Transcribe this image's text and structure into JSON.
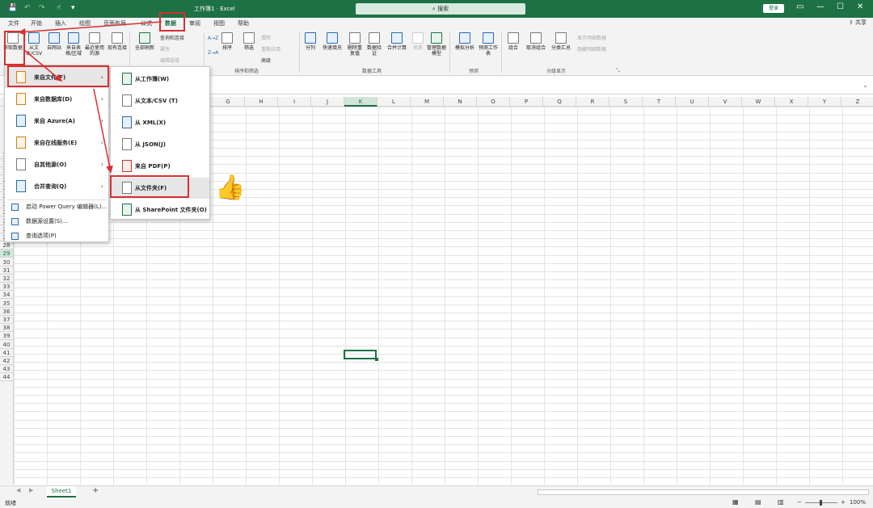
{
  "app": {
    "title": "工作簿1 · Excel",
    "search_placeholder": "搜索",
    "signin": "登录",
    "share": "共享"
  },
  "quick_access": {
    "save_icon": "save-icon",
    "undo_icon": "undo-icon",
    "redo_icon": "redo-icon",
    "touch_icon": "touch-mode-icon",
    "more_icon": "chevron-down-icon"
  },
  "window_controls": {
    "ribbon_toggle": "▭",
    "minimize": "—",
    "restore": "☐",
    "close": "✕"
  },
  "tabs": [
    "文件",
    "开始",
    "插入",
    "绘图",
    "页面布局",
    "公式",
    "数据",
    "审阅",
    "视图",
    "帮助"
  ],
  "active_tab": "数据",
  "ribbon": {
    "get_data": "获取数据",
    "from_text_csv": "从文本/CSV",
    "from_web": "自网站",
    "from_table": "来自表格/区域",
    "recent_sources": "最近使用的源",
    "existing_connections": "现有连接",
    "refresh_all": "全部刷新",
    "queries_connections": "查询和连接",
    "properties": "属性",
    "edit_links": "编辑链接",
    "sort_asc": "A→Z",
    "sort_desc": "Z→A",
    "sort": "排序",
    "filter": "筛选",
    "clear": "清除",
    "reapply": "重新应用",
    "advanced": "高级",
    "sort_filter_group": "排序和筛选",
    "text_to_columns": "分列",
    "flash_fill": "快速填充",
    "remove_duplicates": "删除重复值",
    "data_validation": "数据验证",
    "consolidate": "合并计算",
    "relationships": "关系",
    "data_model": "管理数据模型",
    "data_tools_group": "数据工具",
    "what_if": "模拟分析",
    "forecast_sheet": "预测工作表",
    "forecast_group": "预测",
    "group": "组合",
    "ungroup": "取消组合",
    "subtotal": "分类汇总",
    "show_detail": "显示明细数据",
    "hide_detail": "隐藏明细数据",
    "outline_group": "分级显示"
  },
  "columns": [
    "G",
    "H",
    "I",
    "J",
    "K",
    "L",
    "M",
    "N",
    "O",
    "P",
    "Q",
    "R",
    "S",
    "T",
    "U",
    "V",
    "W",
    "X",
    "Y",
    "Z"
  ],
  "rows": [
    "17",
    "18",
    "19",
    "20",
    "21",
    "22",
    "23",
    "24",
    "25",
    "26",
    "27",
    "28",
    "29",
    "30",
    "31",
    "32",
    "33",
    "34",
    "35",
    "36",
    "37",
    "38",
    "39",
    "40",
    "41",
    "42",
    "43",
    "44"
  ],
  "selected_column": "K",
  "selected_row": "29",
  "get_data_menu": {
    "items": [
      {
        "label": "来自文件(F)",
        "icon": "file-icon",
        "submenu": true
      },
      {
        "label": "来自数据库(D)",
        "icon": "database-icon",
        "submenu": true
      },
      {
        "label": "来自 Azure(A)",
        "icon": "azure-icon",
        "submenu": true
      },
      {
        "label": "来自在线服务(E)",
        "icon": "online-services-icon",
        "submenu": true
      },
      {
        "label": "自其他源(O)",
        "icon": "other-sources-icon",
        "submenu": true
      },
      {
        "label": "合并查询(Q)",
        "icon": "combine-queries-icon",
        "submenu": true
      }
    ],
    "footer": [
      {
        "label": "启动 Power Query 编辑器(L)..."
      },
      {
        "label": "数据源设置(S)..."
      },
      {
        "label": "查询选项(P)"
      }
    ]
  },
  "from_file_menu": {
    "items": [
      {
        "label": "从工作簿(W)",
        "icon": "workbook-icon"
      },
      {
        "label": "从文本/CSV (T)",
        "icon": "text-csv-icon"
      },
      {
        "label": "从 XML(X)",
        "icon": "xml-icon"
      },
      {
        "label": "从 JSON(J)",
        "icon": "json-icon"
      },
      {
        "label": "来自 PDF(P)",
        "icon": "pdf-icon"
      },
      {
        "label": "从文件夹(F)",
        "icon": "folder-icon"
      },
      {
        "label": "从 SharePoint 文件夹(O)",
        "icon": "sharepoint-icon"
      }
    ]
  },
  "icon_glyphs": {
    "json": "JSON",
    "pdf": "PDF",
    "sharepoint": "S",
    "excel": "X",
    "thumb": "👍"
  },
  "sheet": {
    "name": "Sheet1",
    "add": "+"
  },
  "status": {
    "ready": "就绪",
    "zoom": "100%"
  },
  "colors": {
    "excel_green": "#1e7145",
    "annotation_red": "#d63031"
  }
}
